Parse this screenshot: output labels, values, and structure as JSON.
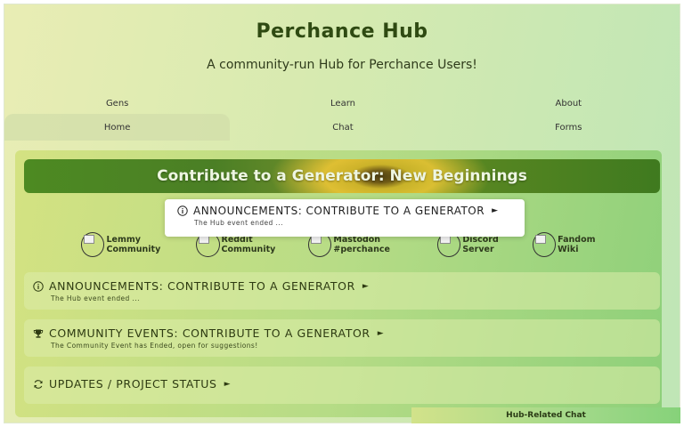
{
  "header": {
    "title": "Perchance Hub",
    "subtitle": "A community-run Hub for Perchance Users!"
  },
  "nav": {
    "row1": [
      "Gens",
      "Learn",
      "About"
    ],
    "row2": [
      "Home",
      "Chat",
      "Forms"
    ],
    "active": "Home"
  },
  "banner": {
    "title": "Contribute to a Generator: New Beginnings"
  },
  "popup": {
    "title": "ANNOUNCEMENTS: CONTRIBUTE TO A GENERATOR",
    "subtitle": "The Hub event ended ...",
    "icon": "info-icon"
  },
  "community_links": [
    {
      "label": "Lemmy Community"
    },
    {
      "label": "Reddit Community"
    },
    {
      "label": "Mastodon #perchance"
    },
    {
      "label": "Discord Server"
    },
    {
      "label": "Fandom Wiki"
    }
  ],
  "sections": [
    {
      "title": "ANNOUNCEMENTS: CONTRIBUTE TO A GENERATOR",
      "subtitle": "The Hub event ended ...",
      "icon": "info-icon"
    },
    {
      "title": "COMMUNITY EVENTS: CONTRIBUTE TO A GENERATOR",
      "subtitle": "The Community Event has Ended, open for suggestions!",
      "icon": "trophy-icon"
    },
    {
      "title": "UPDATES / PROJECT STATUS",
      "subtitle": "",
      "icon": "refresh-icon"
    }
  ],
  "chat_tab": {
    "label": "Hub-Related Chat"
  },
  "colors": {
    "title": "#2f4a12",
    "banner": "#4b7f25",
    "panel": "#b7dc86"
  }
}
